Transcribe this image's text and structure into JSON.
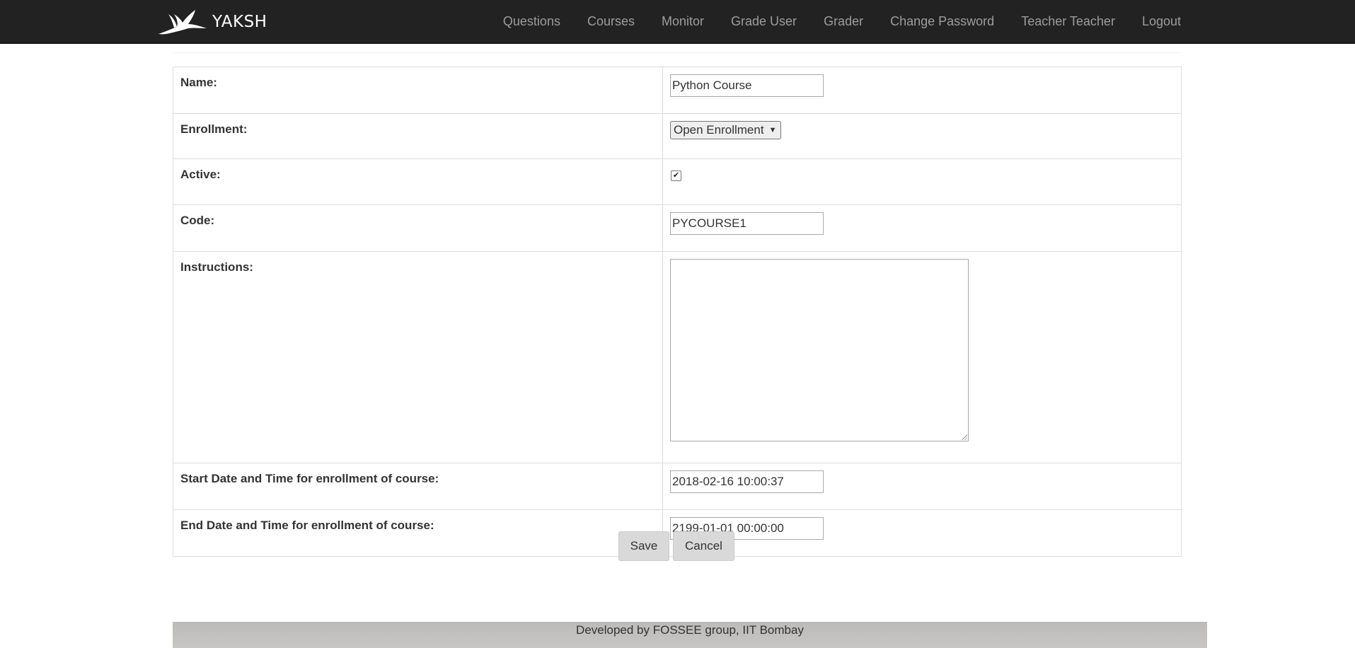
{
  "navbar": {
    "brand": "YAKSH",
    "logo_icon": "crane-bird-logo",
    "links": [
      "Questions",
      "Courses",
      "Monitor",
      "Grade User",
      "Grader",
      "Change Password",
      "Teacher Teacher",
      "Logout"
    ]
  },
  "form": {
    "name": {
      "label": "Name:",
      "value": "Python Course"
    },
    "enrollment": {
      "label": "Enrollment:",
      "value": "Open Enrollment"
    },
    "active": {
      "label": "Active:",
      "checked": true
    },
    "code": {
      "label": "Code:",
      "value": "PYCOURSE1"
    },
    "instructions": {
      "label": "Instructions:",
      "value": ""
    },
    "start_date": {
      "label": "Start Date and Time for enrollment of course:",
      "value": "2018-02-16 10:00:37"
    },
    "end_date": {
      "label": "End Date and Time for enrollment of course:",
      "value": "2199-01-01 00:00:00"
    }
  },
  "actions": {
    "save": "Save",
    "cancel": "Cancel"
  },
  "footer": {
    "text": "Developed by FOSSEE group, IIT Bombay"
  },
  "colors": {
    "navbar_bg": "#222222",
    "nav_link": "#9d9d9d",
    "button_bg": "#d9d9d9",
    "footer_bg": "#c4c2c1"
  }
}
